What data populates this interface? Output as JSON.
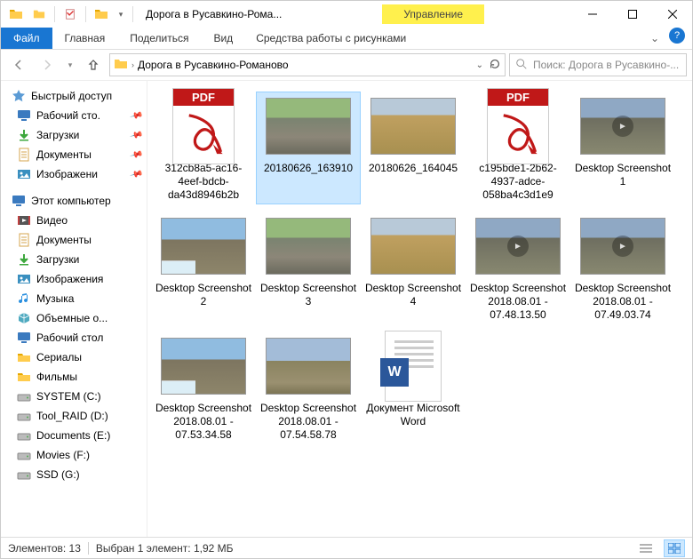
{
  "window": {
    "title": "Дорога в Русавкино-Рома...",
    "contextTab": "Управление",
    "contextSubtitle": "Средства работы с рисунками"
  },
  "ribbon": {
    "file": "Файл",
    "tabs": [
      "Главная",
      "Поделиться",
      "Вид"
    ]
  },
  "address": {
    "crumb": "Дорога в Русавкино-Романово"
  },
  "search": {
    "placeholder": "Поиск: Дорога в Русавкино-..."
  },
  "sidebar": {
    "quick": {
      "label": "Быстрый доступ",
      "items": [
        {
          "icon": "monitor",
          "label": "Рабочий сто.",
          "pin": true
        },
        {
          "icon": "down",
          "label": "Загрузки",
          "pin": true
        },
        {
          "icon": "doc",
          "label": "Документы",
          "pin": true
        },
        {
          "icon": "img",
          "label": "Изображени",
          "pin": true
        }
      ]
    },
    "pc": {
      "label": "Этот компьютер",
      "items": [
        {
          "icon": "video",
          "label": "Видео"
        },
        {
          "icon": "doc",
          "label": "Документы"
        },
        {
          "icon": "down",
          "label": "Загрузки"
        },
        {
          "icon": "img",
          "label": "Изображения"
        },
        {
          "icon": "music",
          "label": "Музыка"
        },
        {
          "icon": "cube",
          "label": "Объемные о..."
        },
        {
          "icon": "monitor",
          "label": "Рабочий стол"
        },
        {
          "icon": "folder",
          "label": "Сериалы"
        },
        {
          "icon": "folder",
          "label": "Фильмы"
        },
        {
          "icon": "drive",
          "label": "SYSTEM (C:)"
        },
        {
          "icon": "drive",
          "label": "Tool_RAID (D:)"
        },
        {
          "icon": "drive",
          "label": "Documents (E:)"
        },
        {
          "icon": "drive",
          "label": "Movies (F:)"
        },
        {
          "icon": "drive",
          "label": "SSD (G:)"
        }
      ]
    }
  },
  "files": [
    {
      "type": "pdf",
      "label": "312cb8a5-ac16-4eef-bdcb-da43d8946b2b",
      "selected": false
    },
    {
      "type": "photo",
      "variant": "p1",
      "label": "20180626_163910",
      "selected": true
    },
    {
      "type": "photo",
      "variant": "p3",
      "label": "20180626_164045",
      "selected": false
    },
    {
      "type": "pdf",
      "label": "c195bde1-2b62-4937-adce-058ba4c3d1e9",
      "selected": false
    },
    {
      "type": "photo",
      "variant": "p4",
      "label": "Desktop Screenshot 1",
      "selected": false
    },
    {
      "type": "photo",
      "variant": "roadmap",
      "label": "Desktop Screenshot 2",
      "selected": false
    },
    {
      "type": "photo",
      "variant": "p1",
      "label": "Desktop Screenshot 3",
      "selected": false
    },
    {
      "type": "photo",
      "variant": "p3",
      "label": "Desktop Screenshot 4",
      "selected": false
    },
    {
      "type": "photo",
      "variant": "p4",
      "label": "Desktop Screenshot 2018.08.01 - 07.48.13.50",
      "selected": false
    },
    {
      "type": "photo",
      "variant": "p4",
      "label": "Desktop Screenshot 2018.08.01 - 07.49.03.74",
      "selected": false
    },
    {
      "type": "photo",
      "variant": "roadmap",
      "label": "Desktop Screenshot 2018.08.01 - 07.53.34.58",
      "selected": false
    },
    {
      "type": "photo",
      "variant": "p2",
      "label": "Desktop Screenshot 2018.08.01 - 07.54.58.78",
      "selected": false
    },
    {
      "type": "word",
      "label": "Документ Microsoft Word",
      "selected": false
    }
  ],
  "status": {
    "count": "Элементов: 13",
    "selection": "Выбран 1 элемент: 1,92 МБ"
  }
}
